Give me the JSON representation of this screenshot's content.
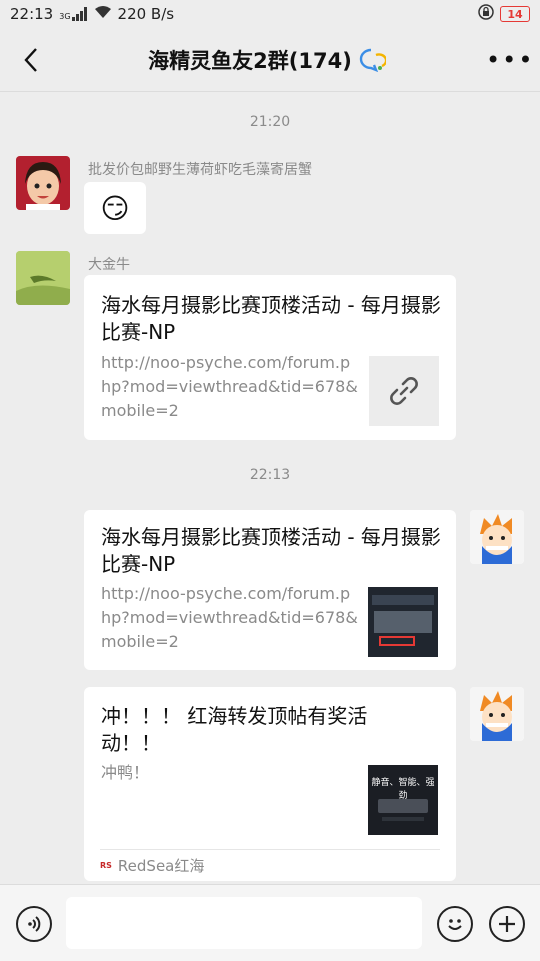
{
  "status": {
    "time": "22:13",
    "network": "3G",
    "speed": "220 B/s",
    "battery": "14"
  },
  "header": {
    "title": "海精灵鱼友2群(174)"
  },
  "timestamps": [
    "21:20",
    "22:13"
  ],
  "messages": [
    {
      "sender": "批发价包邮野生薄荷虾吃毛藻寄居蟹",
      "type": "emoji",
      "content": "😏"
    },
    {
      "sender": "大金牛",
      "type": "link",
      "title": "海水每月摄影比赛顶楼活动 - 每月摄影比赛-NP",
      "desc": "http://noo-psyche.com/forum.php?mod=viewthread&tid=678&mobile=2"
    },
    {
      "sender": "",
      "type": "link",
      "title": "海水每月摄影比赛顶楼活动 - 每月摄影比赛-NP",
      "desc": "http://noo-psyche.com/forum.php?mod=viewthread&tid=678&mobile=2"
    },
    {
      "sender": "",
      "type": "link",
      "title": "冲！！！ 红海转发顶帖有奖活动！！",
      "desc": "冲鸭！",
      "source": "RedSea红海",
      "thumb_text": "静音、智能、强劲"
    }
  ],
  "colors": {
    "background": "#ededed",
    "bubble": "#ffffff",
    "accent": "#e53935"
  }
}
